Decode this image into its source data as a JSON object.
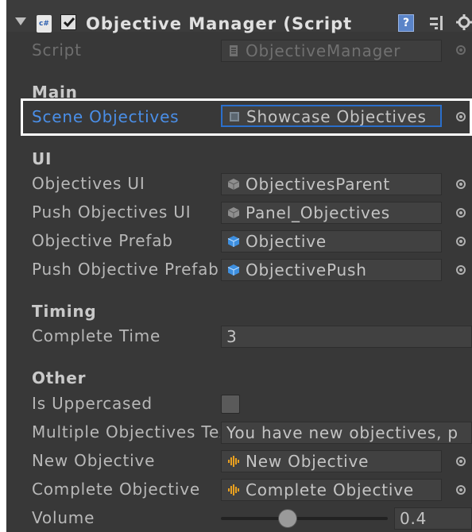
{
  "component": {
    "title": "Objective Manager (Script",
    "enabled": true,
    "script_icon_text": "c#"
  },
  "script": {
    "label": "Script",
    "value": "ObjectiveManager"
  },
  "sections": {
    "main": "Main",
    "ui": "UI",
    "timing": "Timing",
    "other": "Other"
  },
  "fields": {
    "scene_objectives": {
      "label": "Scene Objectives",
      "value": "Showcase Objectives"
    },
    "objectives_ui": {
      "label": "Objectives UI",
      "value": "ObjectivesParent"
    },
    "push_objectives_ui": {
      "label": "Push Objectives UI",
      "value": "Panel_Objectives"
    },
    "objective_prefab": {
      "label": "Objective Prefab",
      "value": "Objective"
    },
    "push_objective_prefab": {
      "label": "Push Objective Prefab",
      "value": "ObjectivePush"
    },
    "complete_time": {
      "label": "Complete Time",
      "value": "3"
    },
    "is_uppercased": {
      "label": "Is Uppercased",
      "checked": false
    },
    "multiple_objectives": {
      "label": "Multiple Objectives Text",
      "value": "You have new objectives, p"
    },
    "new_objective": {
      "label": "New Objective",
      "value": "New Objective"
    },
    "complete_objective": {
      "label": "Complete Objective",
      "value": "Complete Objective"
    },
    "volume": {
      "label": "Volume",
      "value": "0.4",
      "level": 0.4
    }
  },
  "colors": {
    "panel_bg": "#383838",
    "selected_label": "#4a8fe8",
    "highlight_outline": "#ffffff",
    "prefab_icon": "#3d8fe0",
    "gameobject_icon": "#8e8e8e",
    "audio_icon": "#e8a020"
  },
  "icons": {
    "foldout": "foldout-arrow-icon",
    "script": "csharp-script-icon",
    "help": "help-book-icon",
    "preset": "preset-icon",
    "settings": "gear-icon",
    "picker": "object-picker-icon"
  }
}
